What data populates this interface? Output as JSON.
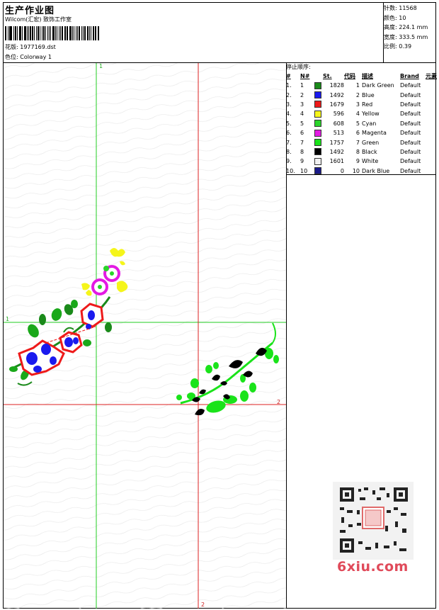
{
  "header": {
    "title": "生产作业图",
    "software": "Wilcom(汇宏) 致饰工作室",
    "design_label": "花版: 1977169.dst",
    "colorway_label": "色位: Colorway 1"
  },
  "stats": {
    "stitches": "针数: 11568",
    "colors": "颜色: 10",
    "height": "高度: 224.1 mm",
    "width": "宽度: 333.5 mm",
    "scale": "比例: 0.39"
  },
  "stop_sequence": {
    "label": "停止顺序:",
    "headers": [
      "#",
      "N#",
      "St.",
      "代码",
      "描述",
      "Brand",
      "元素"
    ],
    "rows": [
      {
        "seq": "1.",
        "n": "1",
        "color": "#1a8a1a",
        "st": "1828",
        "code": "1",
        "desc": "Dark Green",
        "brand": "Default"
      },
      {
        "seq": "2.",
        "n": "2",
        "color": "#1a1aee",
        "st": "1492",
        "code": "2",
        "desc": "Blue",
        "brand": "Default"
      },
      {
        "seq": "3.",
        "n": "3",
        "color": "#ee1a1a",
        "st": "1679",
        "code": "3",
        "desc": "Red",
        "brand": "Default"
      },
      {
        "seq": "4.",
        "n": "4",
        "color": "#f5f51a",
        "st": "596",
        "code": "4",
        "desc": "Yellow",
        "brand": "Default"
      },
      {
        "seq": "5.",
        "n": "5",
        "color": "#2ad52a",
        "st": "608",
        "code": "5",
        "desc": "Cyan",
        "brand": "Default"
      },
      {
        "seq": "6.",
        "n": "6",
        "color": "#e31ae3",
        "st": "513",
        "code": "6",
        "desc": "Magenta",
        "brand": "Default"
      },
      {
        "seq": "7.",
        "n": "7",
        "color": "#1ae31a",
        "st": "1757",
        "code": "7",
        "desc": "Green",
        "brand": "Default"
      },
      {
        "seq": "8.",
        "n": "8",
        "color": "#000000",
        "st": "1492",
        "code": "8",
        "desc": "Black",
        "brand": "Default"
      },
      {
        "seq": "9.",
        "n": "9",
        "color": "#f2f2f2",
        "st": "1601",
        "code": "9",
        "desc": "White",
        "brand": "Default"
      },
      {
        "seq": "10.",
        "n": "10",
        "color": "#1a1a8a",
        "st": "0",
        "code": "10",
        "desc": "Dark Blue",
        "brand": "Default"
      }
    ]
  },
  "design_view": {
    "marker_1_top": "1",
    "marker_1_left": "1",
    "marker_2_right": "2",
    "marker_2_bottom": "2",
    "guide_green": "#22cc22",
    "guide_red": "#dd2222"
  },
  "watermark": {
    "brand_text": "6xiu.com",
    "qr_icon": "qr-code-icon"
  }
}
